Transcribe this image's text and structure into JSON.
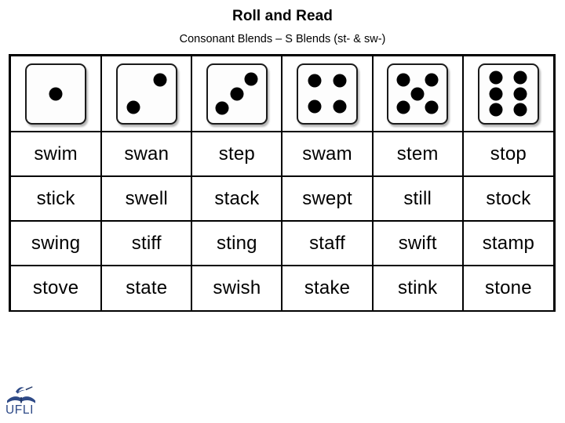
{
  "heading": {
    "title": "Roll and Read",
    "subtitle": "Consonant Blends – S Blends (st- & sw-)"
  },
  "dice": [
    {
      "name": "die-1",
      "value": 1,
      "pips": [
        [
          50,
          50
        ]
      ]
    },
    {
      "name": "die-2",
      "value": 2,
      "pips": [
        [
          73,
          27
        ],
        [
          27,
          73
        ]
      ]
    },
    {
      "name": "die-3",
      "value": 3,
      "pips": [
        [
          75,
          25
        ],
        [
          50,
          50
        ],
        [
          25,
          75
        ]
      ]
    },
    {
      "name": "die-4",
      "value": 4,
      "pips": [
        [
          28,
          28
        ],
        [
          72,
          28
        ],
        [
          28,
          72
        ],
        [
          72,
          72
        ]
      ]
    },
    {
      "name": "die-5",
      "value": 5,
      "pips": [
        [
          26,
          26
        ],
        [
          74,
          26
        ],
        [
          50,
          50
        ],
        [
          26,
          74
        ],
        [
          74,
          74
        ]
      ]
    },
    {
      "name": "die-6",
      "value": 6,
      "pips": [
        [
          29,
          22
        ],
        [
          71,
          22
        ],
        [
          29,
          50
        ],
        [
          71,
          50
        ],
        [
          29,
          78
        ],
        [
          71,
          78
        ]
      ]
    }
  ],
  "columns": [
    1,
    2,
    3,
    4,
    5,
    6
  ],
  "word_rows": [
    [
      "swim",
      "swan",
      "step",
      "swam",
      "stem",
      "stop"
    ],
    [
      "stick",
      "swell",
      "stack",
      "swept",
      "still",
      "stock"
    ],
    [
      "swing",
      "stiff",
      "sting",
      "staff",
      "swift",
      "stamp"
    ],
    [
      "stove",
      "state",
      "swish",
      "stake",
      "stink",
      "stone"
    ]
  ],
  "logo": {
    "text": "UFLI",
    "color": "#2e4a87",
    "icon": "open-book-with-bird"
  },
  "colors": {
    "border": "#000000",
    "background": "#ffffff",
    "pip": "#000000",
    "logo_navy": "#2e4a87"
  }
}
